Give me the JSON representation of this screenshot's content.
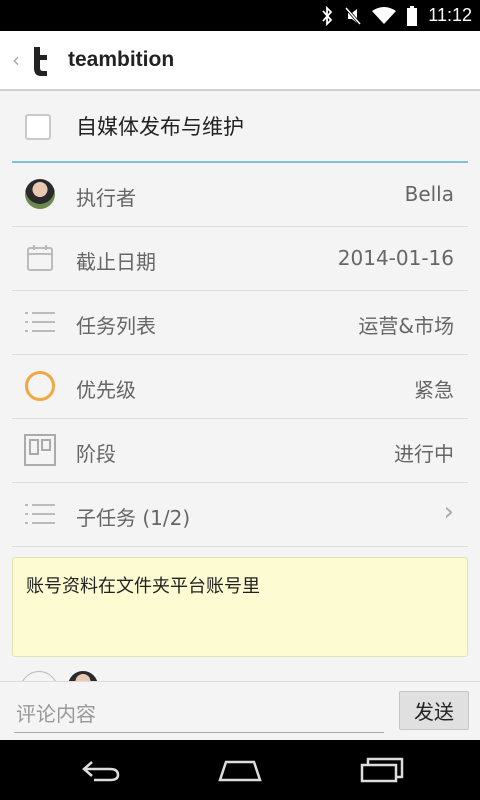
{
  "status_bar": {
    "time": "11:12"
  },
  "action_bar": {
    "back_glyph": "‹",
    "app_title": "teambition"
  },
  "task": {
    "title": "自媒体发布与维护",
    "checked": false
  },
  "fields": {
    "assignee": {
      "label": "执行者",
      "value": "Bella"
    },
    "due_date": {
      "label": "截止日期",
      "value": "2014-01-16"
    },
    "task_list": {
      "label": "任务列表",
      "value": "运营&市场"
    },
    "priority": {
      "label": "优先级",
      "value": "紧急",
      "color": "#f0a840"
    },
    "stage": {
      "label": "阶段",
      "value": "进行中"
    },
    "subtasks": {
      "label": "子任务 (1/2)",
      "chevron": "›"
    }
  },
  "note": {
    "text": "账号资料在文件夹平台账号里"
  },
  "comment": {
    "placeholder": "评论内容",
    "send_label": "发送"
  },
  "colors": {
    "accent": "#7fc1d6",
    "note_bg": "#fdfbd2",
    "priority": "#f0a840"
  },
  "icons": {
    "status": [
      "bluetooth-icon",
      "mute-icon",
      "wifi-icon",
      "battery-icon"
    ],
    "nav": [
      "back-nav-icon",
      "home-nav-icon",
      "recents-nav-icon"
    ]
  }
}
